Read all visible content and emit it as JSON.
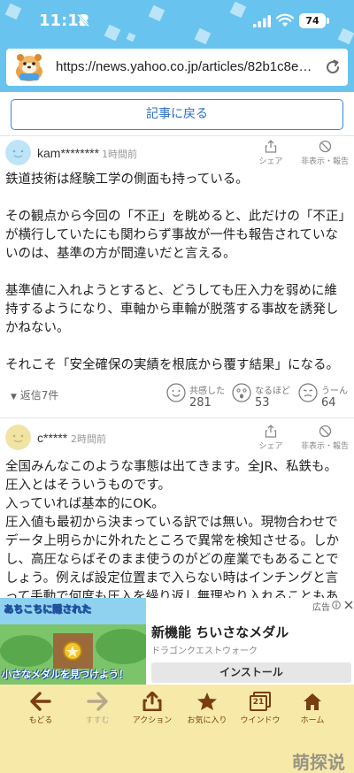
{
  "status": {
    "time": "11:12",
    "battery": "74"
  },
  "browser": {
    "url": "https://news.yahoo.co.jp/articles/82b1c8e8f..."
  },
  "nav": {
    "back_to_article": "記事に戻る"
  },
  "comments": [
    {
      "user": "kam********",
      "time_ago": "1時間前",
      "share_label": "シェア",
      "hide_label": "非表示・報告",
      "paragraphs": [
        "鉄道技術は経験工学の側面も持っている。",
        "その観点から今回の「不正」を眺めると、此だけの「不正」が横行していたにも関わらず事故が一件も報告されていないのは、基準の方が間違いだと言える。",
        "基準値に入れようとすると、どうしても圧入力を弱めに維持するようになり、車軸から車輪が脱落する事故を誘発しかねない。",
        "それこそ「安全確保の実績を根底から覆す結果」になる。"
      ],
      "replies": "返信7件",
      "reactions": [
        {
          "label": "共感した",
          "count": "281"
        },
        {
          "label": "なるほど",
          "count": "53"
        },
        {
          "label": "うーん",
          "count": "64"
        }
      ]
    },
    {
      "user": "c*****",
      "time_ago": "2時間前",
      "share_label": "シェア",
      "hide_label": "非表示・報告",
      "lines": [
        "全国みんなこのような事態は出てきます。全JR、私鉄も。圧入とはそういうものです。",
        "入っていれば基本的にOK。",
        "圧入値も最初から決まっている訳では無い。現物合わせでデータ上明らかに外れたところで異常を検知させる。しかし、高圧ならばそのまま使うのがどの産業でもあることでしょう。例えば設定位置まで入らない時はインチングと言って手動で何度も圧入を繰り返し無理やり入れることもある。低圧は抜けると怖いから対応が変わってきますが、基本高圧は実"
      ]
    }
  ],
  "ad": {
    "badge": "広告",
    "banner_top": "あちこちに隠された",
    "banner_bottom": "小さなメダルを見つけよう！",
    "title": "新機能 ちいさなメダル",
    "subtitle": "ドラゴンクエストウォーク",
    "install": "インストール"
  },
  "toolbar": {
    "items": [
      "もどる",
      "すすむ",
      "アクション",
      "お気に入り",
      "ウインドウ",
      "ホーム"
    ],
    "window_count": "21"
  },
  "watermark": "萌探说"
}
